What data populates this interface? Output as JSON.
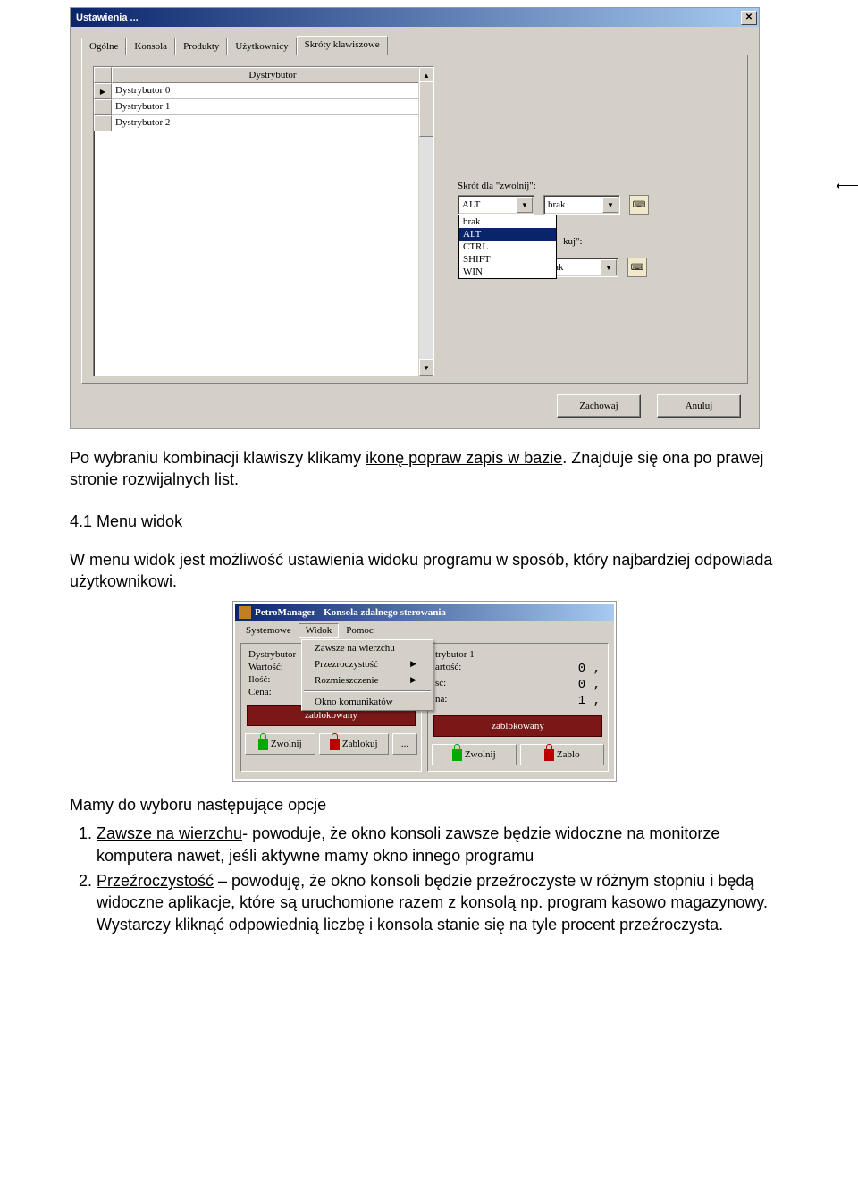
{
  "win1": {
    "title": "Ustawienia ...",
    "tabs": [
      "Ogólne",
      "Konsola",
      "Produkty",
      "Użytkownicy",
      "Skróty klawiszowe"
    ],
    "active_tab_index": 4,
    "grid": {
      "header": "Dystrybutor",
      "rows": [
        "Dystrybutor 0",
        "Dystrybutor 1",
        "Dystrybutor 2"
      ]
    },
    "shortcut1": {
      "label": "Skrót dla \"zwolnij\":",
      "modifier_value": "ALT",
      "key_value": "brak",
      "options": [
        "brak",
        "ALT",
        "CTRL",
        "SHIFT",
        "WIN"
      ],
      "selected_option_index": 1
    },
    "shortcut2": {
      "partial_label": "kuj\":",
      "key_value": "brak"
    },
    "buttons": {
      "save": "Zachowaj",
      "cancel": "Anuluj"
    }
  },
  "body": {
    "p1a": "Po wybraniu kombinacji klawiszy klikamy ",
    "p1_link": "ikonę popraw zapis w bazie",
    "p1b": ". Znajduje się ona po prawej stronie rozwijalnych list.",
    "h41": "4.1 Menu widok",
    "p2": "W menu widok jest możliwość ustawienia widoku programu w sposób, który najbardziej odpowiada użytkownikowi.",
    "p3": "Mamy do wyboru następujące opcje",
    "li1_a": "Zawsze na wierzchu",
    "li1_b": "- powoduje, że okno konsoli zawsze będzie widoczne na monitorze komputera nawet, jeśli aktywne mamy okno innego programu",
    "li2_a": "Przeźroczystość",
    "li2_b": " – powoduję, że okno konsoli będzie przeźroczyste w różnym stopniu i będą widoczne aplikacje, które są uruchomione razem z konsolą np. program kasowo magazynowy. Wystarczy kliknąć odpowiednią liczbę i konsola stanie się na tyle procent przeźroczysta."
  },
  "win2": {
    "title": "PetroManager - Konsola zdalnego sterowania",
    "menubar": [
      "Systemowe",
      "Widok",
      "Pomoc"
    ],
    "open_menu_index": 1,
    "menu_items": [
      {
        "label": "Zawsze na wierzchu",
        "arrow": false
      },
      {
        "label": "Przezroczystość",
        "arrow": true
      },
      {
        "label": "Rozmieszczenie",
        "arrow": true
      }
    ],
    "menu_sep_after": 2,
    "menu_items2": [
      {
        "label": "Okno komunikatów",
        "arrow": false
      }
    ],
    "panel_left": {
      "title": "Dystrybutor",
      "rows": [
        {
          "k": "Wartość:",
          "v": ""
        },
        {
          "k": "Ilość:",
          "v": ""
        },
        {
          "k": "Cena:",
          "v": ""
        }
      ],
      "status": "zablokowany",
      "btns": [
        {
          "label": "Zwolnij",
          "lock": "green"
        },
        {
          "label": "Zablokuj",
          "lock": "red"
        },
        {
          "label": "...",
          "lock": ""
        }
      ]
    },
    "panel_right": {
      "title": "trybutor 1",
      "rows": [
        {
          "k": "artość:",
          "v": "0 ,"
        },
        {
          "k": "ść:",
          "v": "0 ,"
        },
        {
          "k": "na:",
          "v": "1 ,"
        }
      ],
      "status": "zablokowany",
      "btns": [
        {
          "label": "Zwolnij",
          "lock": "green"
        },
        {
          "label": "Zablo",
          "lock": "red"
        }
      ]
    }
  }
}
